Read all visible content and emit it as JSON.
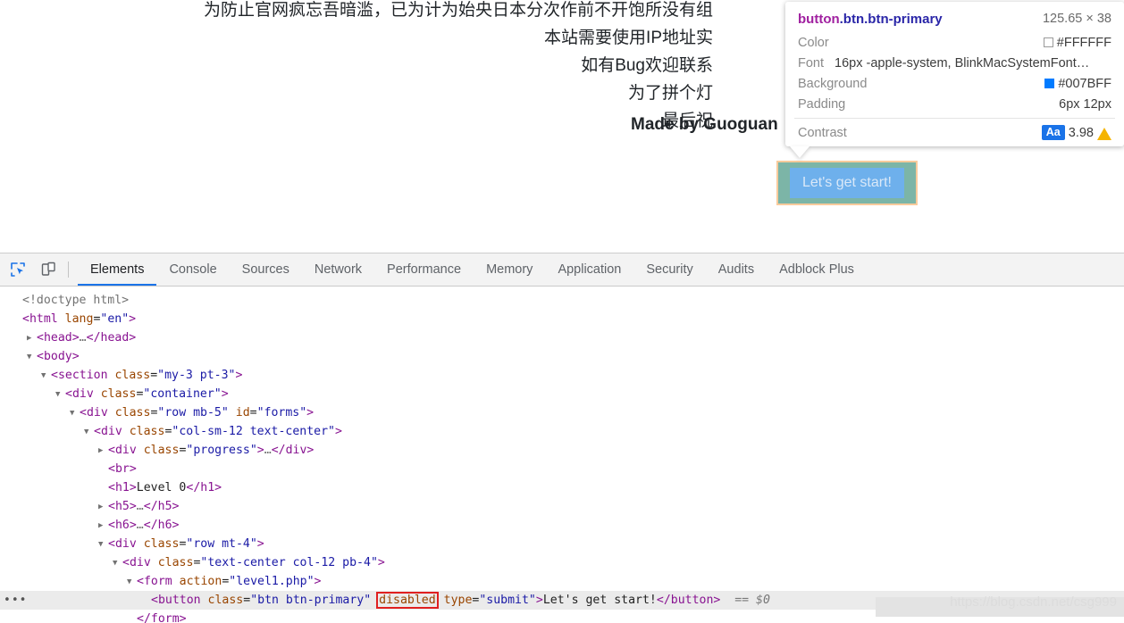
{
  "page": {
    "text_lines": [
      "为防止官网疯忘吾暗滥，已为计为始央日本分次作前不开饱所没有组",
      "本站需要使用IP地址实",
      "如有Bug欢迎联系",
      "为了拼个灯",
      "最后祝"
    ],
    "made_by": "Made by Guoguan",
    "button_label": "Let's get start!"
  },
  "tooltip": {
    "selector_tag": "button",
    "selector_classes": ".btn.btn-primary",
    "dimensions": "125.65 × 38",
    "rows": [
      {
        "key": "Color",
        "value": "#FFFFFF",
        "swatch": "white-swatch"
      },
      {
        "key": "Background",
        "value": "#007BFF",
        "swatch": "blue-swatch"
      },
      {
        "key": "Padding",
        "value": "6px 12px",
        "swatch": ""
      }
    ],
    "font_key": "Font",
    "font_value": "16px -apple-system, BlinkMacSystemFont…",
    "contrast_key": "Contrast",
    "contrast_chip": "Aa",
    "contrast_value": "3.98",
    "colors": {
      "accent": "#007BFF",
      "chip": "#1a73e8",
      "warning": "#f5b400"
    }
  },
  "devtools": {
    "icons": [
      {
        "name": "inspect-element-icon",
        "active": true
      },
      {
        "name": "device-toolbar-icon",
        "active": false
      }
    ],
    "tabs": [
      {
        "label": "Elements",
        "active": true
      },
      {
        "label": "Console",
        "active": false
      },
      {
        "label": "Sources",
        "active": false
      },
      {
        "label": "Network",
        "active": false
      },
      {
        "label": "Performance",
        "active": false
      },
      {
        "label": "Memory",
        "active": false
      },
      {
        "label": "Application",
        "active": false
      },
      {
        "label": "Security",
        "active": false
      },
      {
        "label": "Audits",
        "active": false
      },
      {
        "label": "Adblock Plus",
        "active": false
      }
    ],
    "dom_lines": [
      {
        "indent": 0,
        "twisty": "none",
        "html": "<span class=\"ellip\">&lt;!doctype html&gt;</span>"
      },
      {
        "indent": 0,
        "twisty": "none",
        "html": "<span class=\"punct\">&lt;</span><span class=\"tag\">html</span> <span class=\"attr\">lang</span>=<span class=\"val\">\"en\"</span><span class=\"punct\">&gt;</span>"
      },
      {
        "indent": 1,
        "twisty": "right",
        "html": "<span class=\"punct\">&lt;</span><span class=\"tag\">head</span><span class=\"punct\">&gt;</span><span class=\"ellip\">…</span><span class=\"punct\">&lt;/</span><span class=\"tag\">head</span><span class=\"punct\">&gt;</span>"
      },
      {
        "indent": 1,
        "twisty": "down",
        "html": "<span class=\"punct\">&lt;</span><span class=\"tag\">body</span><span class=\"punct\">&gt;</span>"
      },
      {
        "indent": 2,
        "twisty": "down",
        "html": "<span class=\"punct\">&lt;</span><span class=\"tag\">section</span> <span class=\"attr\">class</span>=<span class=\"val\">\"my-3 pt-3\"</span><span class=\"punct\">&gt;</span>"
      },
      {
        "indent": 3,
        "twisty": "down",
        "html": "<span class=\"punct\">&lt;</span><span class=\"tag\">div</span> <span class=\"attr\">class</span>=<span class=\"val\">\"container\"</span><span class=\"punct\">&gt;</span>"
      },
      {
        "indent": 4,
        "twisty": "down",
        "html": "<span class=\"punct\">&lt;</span><span class=\"tag\">div</span> <span class=\"attr\">class</span>=<span class=\"val\">\"row mb-5\"</span> <span class=\"attr\">id</span>=<span class=\"val\">\"forms\"</span><span class=\"punct\">&gt;</span>"
      },
      {
        "indent": 5,
        "twisty": "down",
        "html": "<span class=\"punct\">&lt;</span><span class=\"tag\">div</span> <span class=\"attr\">class</span>=<span class=\"val\">\"col-sm-12 text-center\"</span><span class=\"punct\">&gt;</span>"
      },
      {
        "indent": 6,
        "twisty": "right",
        "html": "<span class=\"punct\">&lt;</span><span class=\"tag\">div</span> <span class=\"attr\">class</span>=<span class=\"val\">\"progress\"</span><span class=\"punct\">&gt;</span><span class=\"ellip\">…</span><span class=\"punct\">&lt;/</span><span class=\"tag\">div</span><span class=\"punct\">&gt;</span>"
      },
      {
        "indent": 6,
        "twisty": "none",
        "html": "<span class=\"punct\">&lt;</span><span class=\"tag\">br</span><span class=\"punct\">&gt;</span>"
      },
      {
        "indent": 6,
        "twisty": "none",
        "html": "<span class=\"punct\">&lt;</span><span class=\"tag\">h1</span><span class=\"punct\">&gt;</span><span class=\"txt\">Level 0</span><span class=\"punct\">&lt;/</span><span class=\"tag\">h1</span><span class=\"punct\">&gt;</span>"
      },
      {
        "indent": 6,
        "twisty": "right",
        "html": "<span class=\"punct\">&lt;</span><span class=\"tag\">h5</span><span class=\"punct\">&gt;</span><span class=\"ellip\">…</span><span class=\"punct\">&lt;/</span><span class=\"tag\">h5</span><span class=\"punct\">&gt;</span>"
      },
      {
        "indent": 6,
        "twisty": "right",
        "html": "<span class=\"punct\">&lt;</span><span class=\"tag\">h6</span><span class=\"punct\">&gt;</span><span class=\"ellip\">…</span><span class=\"punct\">&lt;/</span><span class=\"tag\">h6</span><span class=\"punct\">&gt;</span>"
      },
      {
        "indent": 6,
        "twisty": "down",
        "html": "<span class=\"punct\">&lt;</span><span class=\"tag\">div</span> <span class=\"attr\">class</span>=<span class=\"val\">\"row mt-4\"</span><span class=\"punct\">&gt;</span>"
      },
      {
        "indent": 7,
        "twisty": "down",
        "html": "<span class=\"punct\">&lt;</span><span class=\"tag\">div</span> <span class=\"attr\">class</span>=<span class=\"val\">\"text-center col-12 pb-4\"</span><span class=\"punct\">&gt;</span>"
      },
      {
        "indent": 8,
        "twisty": "down",
        "html": "<span class=\"punct\">&lt;</span><span class=\"tag\">form</span> <span class=\"attr\">action</span>=<span class=\"val\">\"level1.php\"</span><span class=\"punct\">&gt;</span>"
      },
      {
        "indent": 9,
        "twisty": "none",
        "selected": true,
        "gutter_dots": true,
        "html": "<span class=\"punct\">&lt;</span><span class=\"tag\">button</span> <span class=\"attr\">class</span>=<span class=\"val\">\"btn btn-primary\"</span> <span class=\"attr attr-hl\">disabled</span> <span class=\"attr\">type</span>=<span class=\"val\">\"submit\"</span><span class=\"punct\">&gt;</span><span class=\"txt\">Let's get start!</span><span class=\"punct\">&lt;/</span><span class=\"tag\">button</span><span class=\"punct\">&gt;</span><span class=\"dollar\">  == $0</span>"
      },
      {
        "indent": 8,
        "twisty": "none",
        "html": "<span class=\"punct\">&lt;/</span><span class=\"tag\">form</span><span class=\"punct\">&gt;</span>"
      }
    ]
  },
  "watermark": {
    "text": "https://blog.csdn.net/csg999"
  }
}
